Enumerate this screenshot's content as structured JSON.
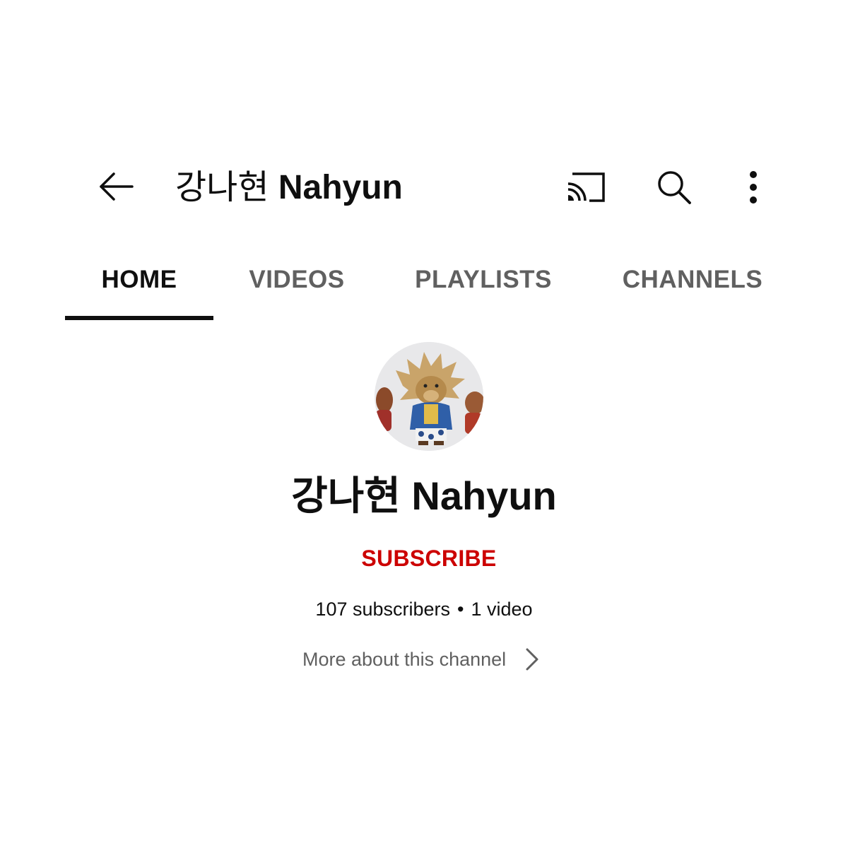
{
  "appbar": {
    "title_ko": "강나현",
    "title_en": "Nahyun",
    "back_icon": "arrow-left-icon",
    "actions": [
      "cast-icon",
      "search-icon",
      "more-vertical-icon"
    ]
  },
  "tabs": [
    {
      "label": "HOME",
      "active": true
    },
    {
      "label": "VIDEOS",
      "active": false
    },
    {
      "label": "PLAYLISTS",
      "active": false
    },
    {
      "label": "CHANNELS",
      "active": false
    }
  ],
  "channel": {
    "name_ko": "강나현",
    "name_en": "Nahyun",
    "subscribe_label": "SUBSCRIBE",
    "subscribers": "107 subscribers",
    "separator": "•",
    "videos": "1 video",
    "more_about": "More about this channel"
  },
  "colors": {
    "subscribe": "#cc0000",
    "text_primary": "#0f0f0f",
    "text_secondary": "#606060",
    "background": "#ffffff"
  }
}
